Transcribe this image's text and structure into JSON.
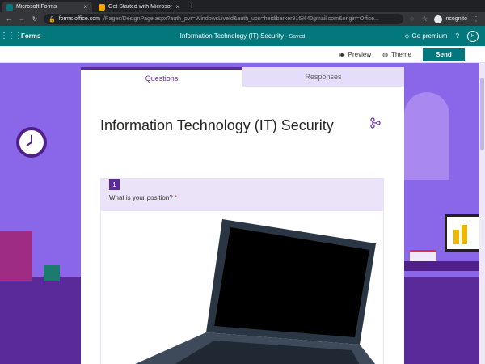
{
  "browser": {
    "tabs": [
      {
        "title": "Microsoft Forms",
        "close": "×",
        "favicon_color": "#03787c"
      },
      {
        "title": "Get Started with Microsof",
        "close": "×",
        "favicon_color": "#f2a600"
      }
    ],
    "new_tab": "+",
    "url_host": "forms.office.com",
    "url_path": "/Pages/DesignPage.aspx?auth_pvr=WindowsLiveId&auth_upn=heidibarker916%40gmail.com&origin=Office...",
    "incognito_label": "Incognito"
  },
  "appbar": {
    "app_name": "Forms",
    "doc_title": "Information Technology (IT) Security",
    "saved": "- Saved",
    "premium": "Go premium",
    "help": "?",
    "avatar": "H"
  },
  "commandbar": {
    "preview": "Preview",
    "theme": "Theme",
    "send": "Send"
  },
  "form": {
    "tabs": {
      "questions": "Questions",
      "responses": "Responses"
    },
    "title": "Information Technology (IT) Security",
    "question": {
      "number": "1",
      "text": "What is your position?",
      "required_mark": "*"
    }
  },
  "colors": {
    "brand": "#03787c",
    "accent": "#5b2a9a",
    "background": "#8a66e8"
  },
  "icons": {
    "branching": "branch-icon",
    "preview": "eye-icon",
    "theme": "palette-icon",
    "premium": "diamond-icon"
  }
}
